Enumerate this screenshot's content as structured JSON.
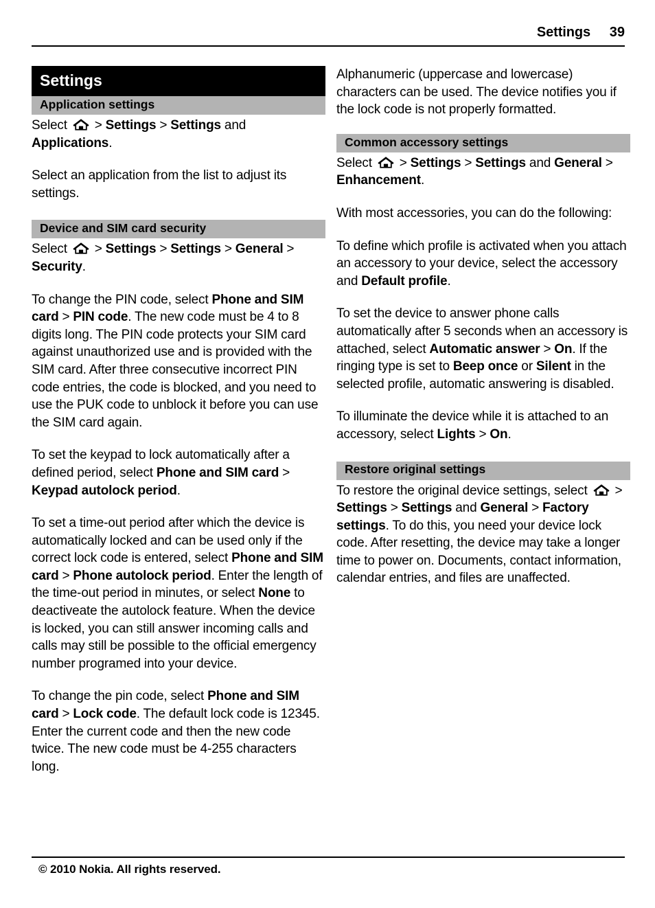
{
  "header": {
    "title": "Settings",
    "page_number": "39"
  },
  "icons": {
    "home": "home-icon"
  },
  "chapter": {
    "title": "Settings"
  },
  "left_column": {
    "sections": [
      {
        "heading": "Application settings",
        "paragraphs": [
          {
            "parts": [
              {
                "text": "Select ",
                "bold": false
              },
              {
                "icon": "home-icon"
              },
              {
                "text": " > ",
                "bold": false
              },
              {
                "text": "Settings ",
                "bold": true
              },
              {
                "text": "> ",
                "bold": false
              },
              {
                "text": "Settings",
                "bold": true
              },
              {
                "text": " and ",
                "bold": false
              },
              {
                "text": "Applications",
                "bold": true
              },
              {
                "text": ".",
                "bold": false
              }
            ]
          },
          {
            "parts": [
              {
                "text": "Select an application from the list to adjust its settings.",
                "bold": false
              }
            ]
          }
        ]
      },
      {
        "heading": "Device and SIM card security",
        "paragraphs": [
          {
            "parts": [
              {
                "text": "Select ",
                "bold": false
              },
              {
                "icon": "home-icon"
              },
              {
                "text": " > ",
                "bold": false
              },
              {
                "text": "Settings ",
                "bold": true
              },
              {
                "text": "> ",
                "bold": false
              },
              {
                "text": "Settings ",
                "bold": true
              },
              {
                "text": "> ",
                "bold": false
              },
              {
                "text": "General ",
                "bold": true
              },
              {
                "text": "> ",
                "bold": false
              },
              {
                "text": "Security",
                "bold": true
              },
              {
                "text": ".",
                "bold": false
              }
            ]
          },
          {
            "parts": [
              {
                "text": "To change the PIN code, select ",
                "bold": false
              },
              {
                "text": "Phone and SIM card ",
                "bold": true
              },
              {
                "text": "> ",
                "bold": false
              },
              {
                "text": "PIN code",
                "bold": true
              },
              {
                "text": ". The new code must be 4 to 8 digits long. The PIN code protects your SIM card against unauthorized use and is provided with the SIM card. After three consecutive incorrect PIN code entries, the code is blocked, and you need to use the PUK code to unblock it before you can use the SIM card again.",
                "bold": false
              }
            ]
          },
          {
            "parts": [
              {
                "text": "To set the keypad to lock automatically after a defined period, select ",
                "bold": false
              },
              {
                "text": "Phone and SIM card ",
                "bold": true
              },
              {
                "text": "> ",
                "bold": false
              },
              {
                "text": "Keypad autolock period",
                "bold": true
              },
              {
                "text": ".",
                "bold": false
              }
            ]
          },
          {
            "parts": [
              {
                "text": "To set a time-out period after which the device is automatically locked and can be used only if the correct lock code is entered, select ",
                "bold": false
              },
              {
                "text": "Phone and SIM card ",
                "bold": true
              },
              {
                "text": "> ",
                "bold": false
              },
              {
                "text": "Phone autolock period",
                "bold": true
              },
              {
                "text": ". Enter the length of the time-out period in minutes, or select ",
                "bold": false
              },
              {
                "text": "None",
                "bold": true
              },
              {
                "text": " to deactiveate the autolock feature. When the device is locked, you can still answer incoming calls and calls may still be possible to the official emergency number programed into your device.",
                "bold": false
              }
            ]
          },
          {
            "parts": [
              {
                "text": "To change the pin code, select ",
                "bold": false
              },
              {
                "text": "Phone and SIM card ",
                "bold": true
              },
              {
                "text": "> ",
                "bold": false
              },
              {
                "text": "Lock code",
                "bold": true
              },
              {
                "text": ". The default lock code is 12345. Enter the current code and then the new code twice. The new code must be 4-255 characters long.",
                "bold": false
              }
            ]
          }
        ]
      }
    ]
  },
  "right_column": {
    "lead_paragraph": {
      "parts": [
        {
          "text": "Alphanumeric (uppercase and lowercase) characters can be used. The device notifies you if the lock code is not properly formatted.",
          "bold": false
        }
      ]
    },
    "sections": [
      {
        "heading": "Common accessory settings",
        "paragraphs": [
          {
            "parts": [
              {
                "text": "Select ",
                "bold": false
              },
              {
                "icon": "home-icon"
              },
              {
                "text": " > ",
                "bold": false
              },
              {
                "text": "Settings ",
                "bold": true
              },
              {
                "text": "> ",
                "bold": false
              },
              {
                "text": "Settings",
                "bold": true
              },
              {
                "text": " and ",
                "bold": false
              },
              {
                "text": "General ",
                "bold": true
              },
              {
                "text": "> ",
                "bold": false
              },
              {
                "text": "Enhancement",
                "bold": true
              },
              {
                "text": ".",
                "bold": false
              }
            ]
          },
          {
            "parts": [
              {
                "text": "With most accessories, you can do the following:",
                "bold": false
              }
            ]
          },
          {
            "parts": [
              {
                "text": "To define which profile is activated when you attach an accessory to your device, select the accessory and ",
                "bold": false
              },
              {
                "text": "Default profile",
                "bold": true
              },
              {
                "text": ".",
                "bold": false
              }
            ]
          },
          {
            "parts": [
              {
                "text": "To set the device to answer phone calls automatically after 5 seconds when an accessory is attached, select ",
                "bold": false
              },
              {
                "text": "Automatic answer ",
                "bold": true
              },
              {
                "text": "> ",
                "bold": false
              },
              {
                "text": "On",
                "bold": true
              },
              {
                "text": ". If the ringing type is set to ",
                "bold": false
              },
              {
                "text": "Beep once",
                "bold": true
              },
              {
                "text": " or ",
                "bold": false
              },
              {
                "text": "Silent",
                "bold": true
              },
              {
                "text": " in the selected profile, automatic answering is disabled.",
                "bold": false
              }
            ]
          },
          {
            "parts": [
              {
                "text": "To illuminate the device while it is attached to an accessory, select ",
                "bold": false
              },
              {
                "text": "Lights ",
                "bold": true
              },
              {
                "text": "> ",
                "bold": false
              },
              {
                "text": "On",
                "bold": true
              },
              {
                "text": ".",
                "bold": false
              }
            ]
          }
        ]
      },
      {
        "heading": "Restore original settings",
        "paragraphs": [
          {
            "parts": [
              {
                "text": "To restore the original device settings, select ",
                "bold": false
              },
              {
                "icon": "home-icon"
              },
              {
                "text": " > ",
                "bold": false
              },
              {
                "text": "Settings ",
                "bold": true
              },
              {
                "text": "> ",
                "bold": false
              },
              {
                "text": "Settings",
                "bold": true
              },
              {
                "text": " and ",
                "bold": false
              },
              {
                "text": "General ",
                "bold": true
              },
              {
                "text": "> ",
                "bold": false
              },
              {
                "text": "Factory settings",
                "bold": true
              },
              {
                "text": ". To do this, you need your device lock code. After resetting, the device may take a longer time to power on. Documents, contact information, calendar entries, and files are unaffected.",
                "bold": false
              }
            ]
          }
        ]
      }
    ]
  },
  "footer": {
    "copyright": "© 2010 Nokia. All rights reserved."
  }
}
